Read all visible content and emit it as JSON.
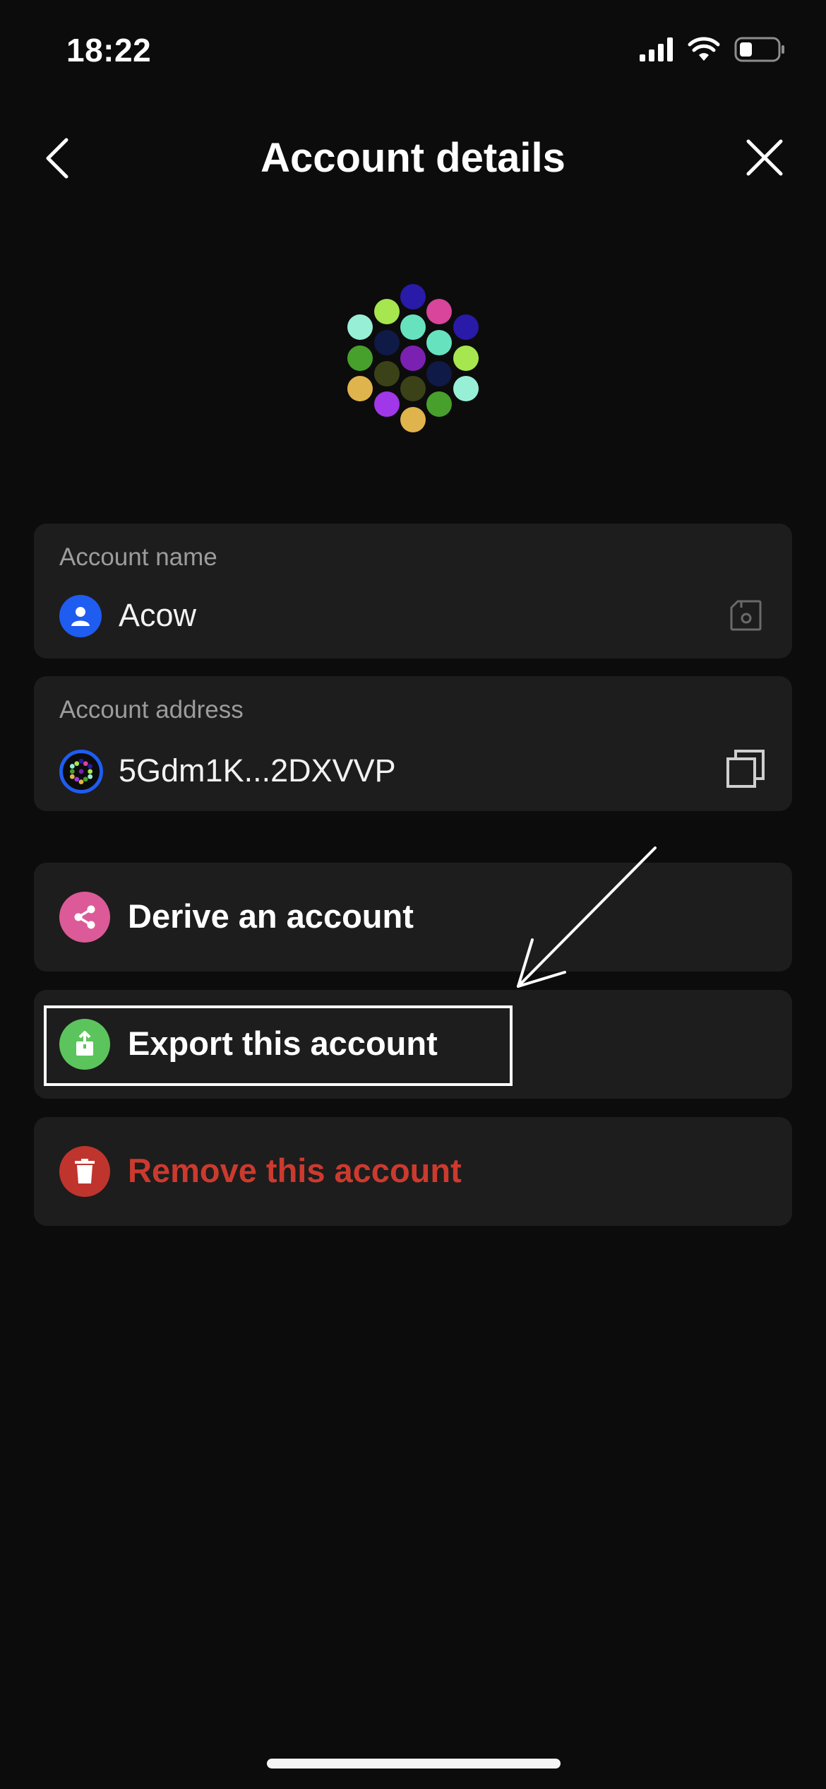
{
  "status_bar": {
    "time": "18:22"
  },
  "header": {
    "title": "Account details",
    "back_icon": "chevron-left-icon",
    "close_icon": "close-icon"
  },
  "account_name": {
    "label": "Account name",
    "value": "Acow",
    "avatar_icon": "person-icon",
    "edit_icon": "save-icon"
  },
  "account_address": {
    "label": "Account address",
    "value": "5Gdm1K...2DXVVP",
    "copy_icon": "copy-icon"
  },
  "actions": [
    {
      "label": "Derive an account",
      "icon": "share-icon",
      "color": "#dc5a97"
    },
    {
      "label": "Export this account",
      "icon": "upload-icon",
      "color": "#5cc45c"
    },
    {
      "label": "Remove this account",
      "icon": "trash-icon",
      "color": "#c0342e"
    }
  ],
  "colors": {
    "background": "#0c0c0c",
    "card": "#1d1d1d",
    "accent_blue": "#1f5cf0",
    "danger_text": "#cc3a2e"
  }
}
